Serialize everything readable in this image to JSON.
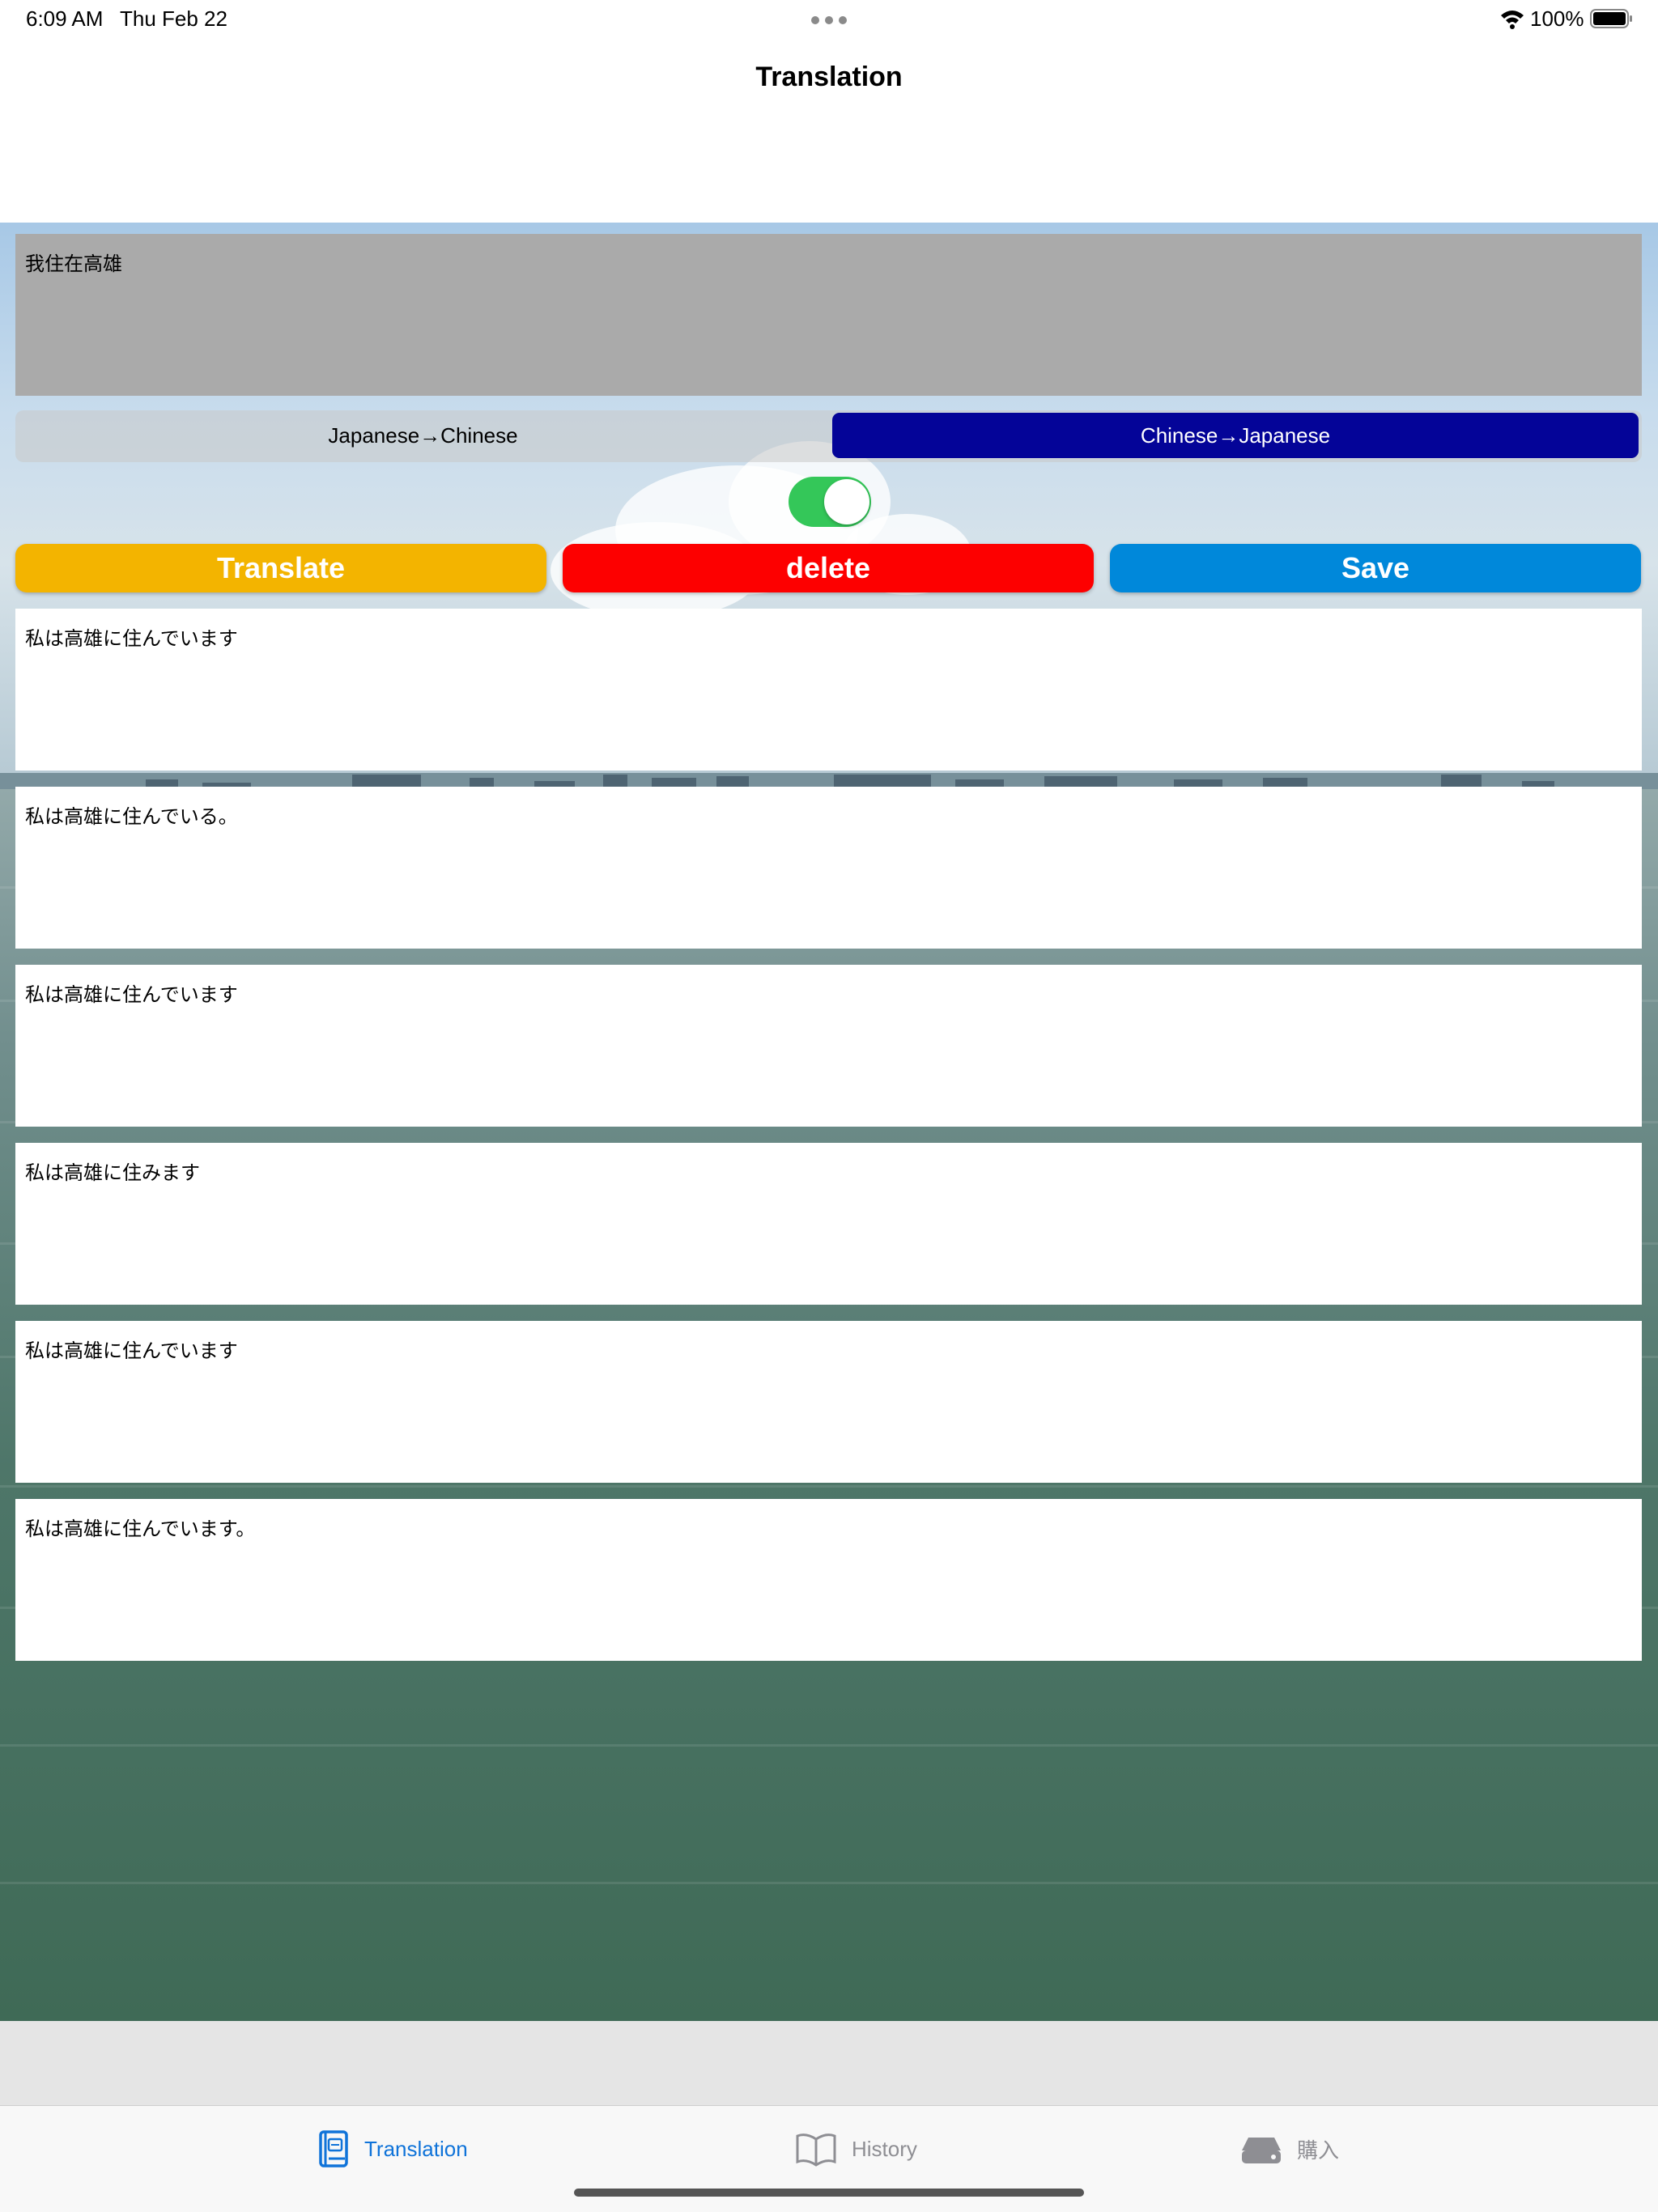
{
  "status_bar": {
    "time": "6:09 AM",
    "date": "Thu Feb 22",
    "battery_percent": "100%"
  },
  "nav": {
    "title": "Translation"
  },
  "input": {
    "text": "我住在高雄"
  },
  "direction": {
    "options": [
      "Japanese→Chinese",
      "Chinese→Japanese"
    ],
    "selected": "Chinese→Japanese",
    "selected_color": "#040498"
  },
  "toggle": {
    "on": true,
    "color": "#34c759"
  },
  "buttons": {
    "translate": {
      "label": "Translate",
      "color": "#f3b400"
    },
    "delete": {
      "label": "delete",
      "color": "#fd0000"
    },
    "save": {
      "label": "Save",
      "color": "#0088da"
    }
  },
  "results": [
    "私は高雄に住んでいます",
    "私は高雄に住んでいる。",
    "私は高雄に住んでいます",
    "私は高雄に住みます",
    "私は高雄に住んでいます",
    "私は高雄に住んでいます。"
  ],
  "tab_bar": {
    "active_color": "#0f73d9",
    "tabs": [
      {
        "label": "Translation",
        "icon": "translate-book-icon",
        "active": true
      },
      {
        "label": "History",
        "icon": "open-book-icon",
        "active": false
      },
      {
        "label": "購入",
        "icon": "drive-icon",
        "active": false
      }
    ]
  }
}
